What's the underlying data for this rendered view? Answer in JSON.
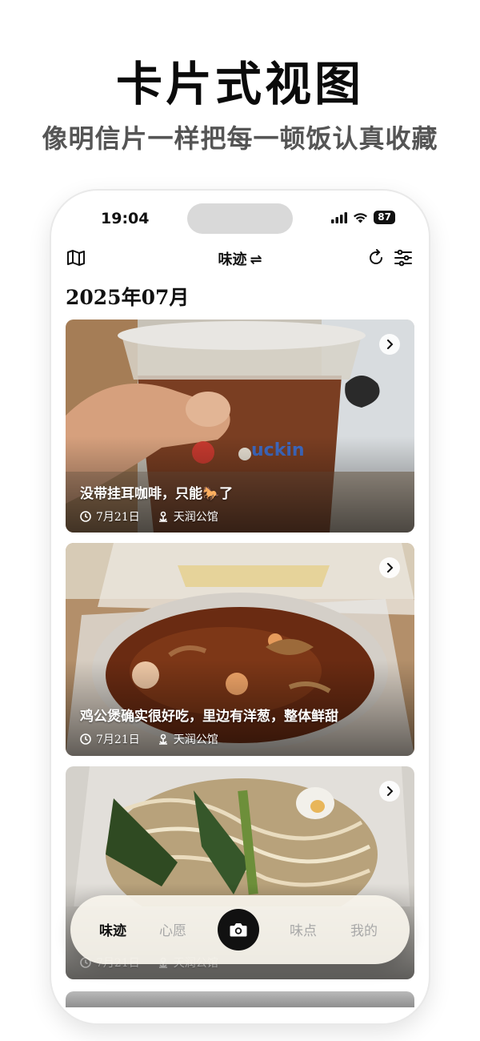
{
  "promo": {
    "title": "卡片式视图",
    "subtitle": "像明信片一样把每一顿饭认真收藏"
  },
  "status_bar": {
    "time": "19:04",
    "battery": "87"
  },
  "header": {
    "title": "味迹",
    "swap_icon": "⇌"
  },
  "month_label": "2025年07月",
  "cards": [
    {
      "caption": "没带挂耳咖啡，只能🐎了",
      "date": "7月21日",
      "place": "天润公馆"
    },
    {
      "caption": "鸡公煲确实很好吃，里边有洋葱，整体鲜甜",
      "date": "7月21日",
      "place": "天润公馆"
    },
    {
      "caption": "",
      "date": "7月21日",
      "place": "天润公馆"
    }
  ],
  "tabbar": {
    "tabs": [
      {
        "label": "味迹",
        "active": true
      },
      {
        "label": "心愿",
        "active": false
      },
      {
        "label": "味点",
        "active": false
      },
      {
        "label": "我的",
        "active": false
      }
    ]
  },
  "colors": {
    "accent": "#111111",
    "inactive": "#a8a8a8",
    "tabbar_bg": "#f8f4ec"
  }
}
